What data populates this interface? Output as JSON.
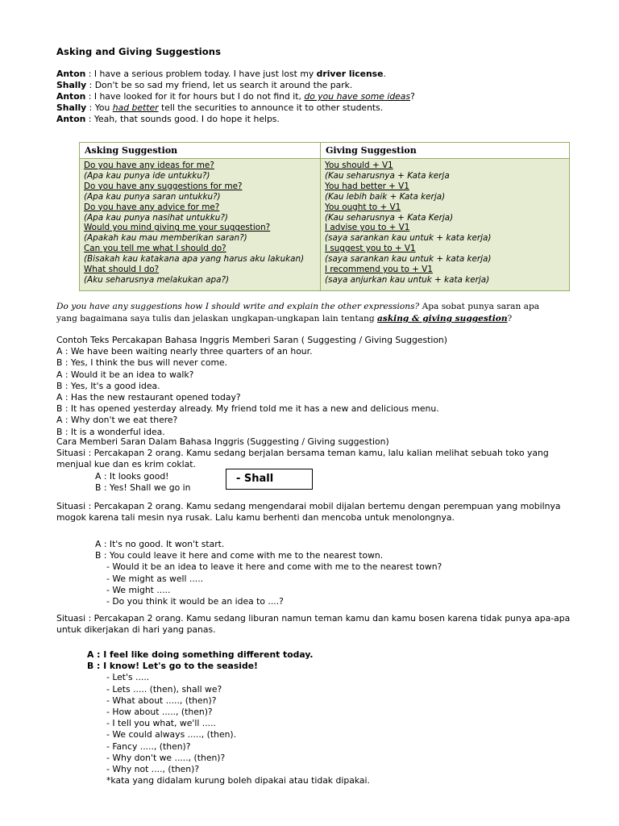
{
  "document": {
    "title": "Asking and Giving Suggestions"
  },
  "opening_dialogue": [
    {
      "speaker": "Anton",
      "sep": " : ",
      "pre": "I have a serious problem today. I have just lost my ",
      "bold": "driver license",
      "post": "."
    },
    {
      "speaker": "Shally",
      "sep": " : ",
      "pre": "Don't be so sad my friend, let us search it around the park.",
      "bold": "",
      "post": ""
    },
    {
      "speaker": "Anton",
      "sep": " : ",
      "pre": "I have looked for it for hours but I do not find it, ",
      "underline_italic": "do you have some ideas",
      "post": "?"
    },
    {
      "speaker": "Shally",
      "sep": " : ",
      "pre": "You ",
      "underline_italic": "had better",
      "post": " tell the securities to announce it to other students."
    },
    {
      "speaker": "Anton",
      "sep": " : ",
      "pre": "Yeah, that sounds good. I do hope it helps.",
      "bold": "",
      "post": ""
    }
  ],
  "table": {
    "headers": [
      "Asking Suggestion",
      "Giving Suggestion"
    ],
    "asking": [
      {
        "en": "Do you have any ideas for me?",
        "id": "(Apa kau punya ide untukku?)"
      },
      {
        "en": "Do you have any suggestions for me?",
        "id": "(Apa kau punya saran untukku?)"
      },
      {
        "en": "Do you have any advice for me?",
        "id": "(Apa kau punya nasihat untukku?)"
      },
      {
        "en": "Would you mind giving me your suggestion?",
        "id": "(Apakah kau mau memberikan saran?)"
      },
      {
        "en": "Can you tell me what I should do?",
        "id": "(Bisakah kau katakana apa yang harus aku lakukan)"
      },
      {
        "en": "What should I do?",
        "id": "(Aku seharusnya melakukan apa?)"
      }
    ],
    "giving": [
      {
        "en": "You should + V1",
        "id": "(Kau seharusnya + Kata kerja"
      },
      {
        "en": "You had better + V1",
        "id": "(Kau lebih baik + Kata kerja)"
      },
      {
        "en": "You ought to + V1",
        "id": "(Kau seharusnya + Kata Kerja)"
      },
      {
        "en": "I advise you to + V1",
        "id": "(saya sarankan kau untuk + kata kerja)"
      },
      {
        "en": "I suggest you to + V1",
        "id": "(saya sarankan kau untuk + kata kerja)"
      },
      {
        "en": "I recommend you to + V1",
        "id": "(saya anjurkan kau untuk + kata kerja)"
      }
    ]
  },
  "serif_paragraph": {
    "italic_part": "Do you have any suggestions how I should write and explain the other expressions?",
    "plain_part": " Apa sobat punya saran apa yang bagaimana saya tulis dan jelaskan ungkapan-ungkapan lain tentang ",
    "emphasis": "asking & giving suggestion",
    "tail": "?"
  },
  "contoh_section": {
    "heading": "Contoh Teks Percakapan Bahasa Inggris Memberi Saran ( Suggesting / Giving Suggestion)",
    "lines": [
      "A : We have been waiting nearly three quarters of an hour.",
      "B : Yes, I think the bus will never come.",
      "A : Would it be an idea to walk?",
      "B : Yes, It's a good idea.",
      "A : Has the new restaurant opened today?",
      "B : It has opened yesterday already. My friend told me it has a new and delicious menu.",
      "A : Why don't we eat there?",
      "B : It is a wonderful idea."
    ]
  },
  "cara_section": {
    "heading": "Cara Memberi Saran Dalam Bahasa Inggris (Suggesting / Giving suggestion)",
    "situasi": "Situasi : Percakapan 2 orang. Kamu sedang berjalan bersama teman kamu, lalu kalian melihat sebuah toko yang menjual kue dan es krim coklat.",
    "dialog": [
      "A : It looks good!",
      "B : Yes! Shall we go in"
    ]
  },
  "shall_box": {
    "label": "- Shall"
  },
  "situasi2": {
    "text": "Situasi : Percakapan 2 orang. Kamu sedang mengendarai mobil dijalan bertemu dengan perempuan yang mobilnya mogok karena tali mesin nya rusak. Lalu kamu berhenti dan mencoba untuk menolongnya.",
    "dialog": [
      "A : It's no good. It won't start.",
      "B : You could leave it here and come with me to the nearest town."
    ],
    "options": [
      "- Would it be an idea to leave it here and come with me to the nearest town?",
      "- We might as well .....",
      "- We might .....",
      "- Do you think it would be an idea to ....?"
    ]
  },
  "situasi3": {
    "text": "Situasi : Percakapan 2 orang. Kamu sedang liburan namun teman kamu dan kamu bosen karena tidak punya apa-apa untuk dikerjakan di hari yang panas.",
    "dialog_bold": [
      "A : I feel like doing something different today.",
      "B : I know! Let's go to the seaside!"
    ],
    "options": [
      "- Let's .....",
      "- Lets ..... (then), shall we?",
      "- What about ....., (then)?",
      "- How about ....., (then)?",
      "- I tell you what, we'll .....",
      "- We could always ....., (then).",
      "- Fancy ....., (then)?",
      "- Why don't we ....., (then)?",
      "- Why not ...., (then)?"
    ],
    "footnote": "*kata yang didalam kurung boleh dipakai atau tidak dipakai."
  },
  "colors": {
    "table_border": "#96ae62",
    "table_body_bg": "#e5ecd2",
    "table_header_bg": "#ffffff",
    "text": "#000000"
  }
}
